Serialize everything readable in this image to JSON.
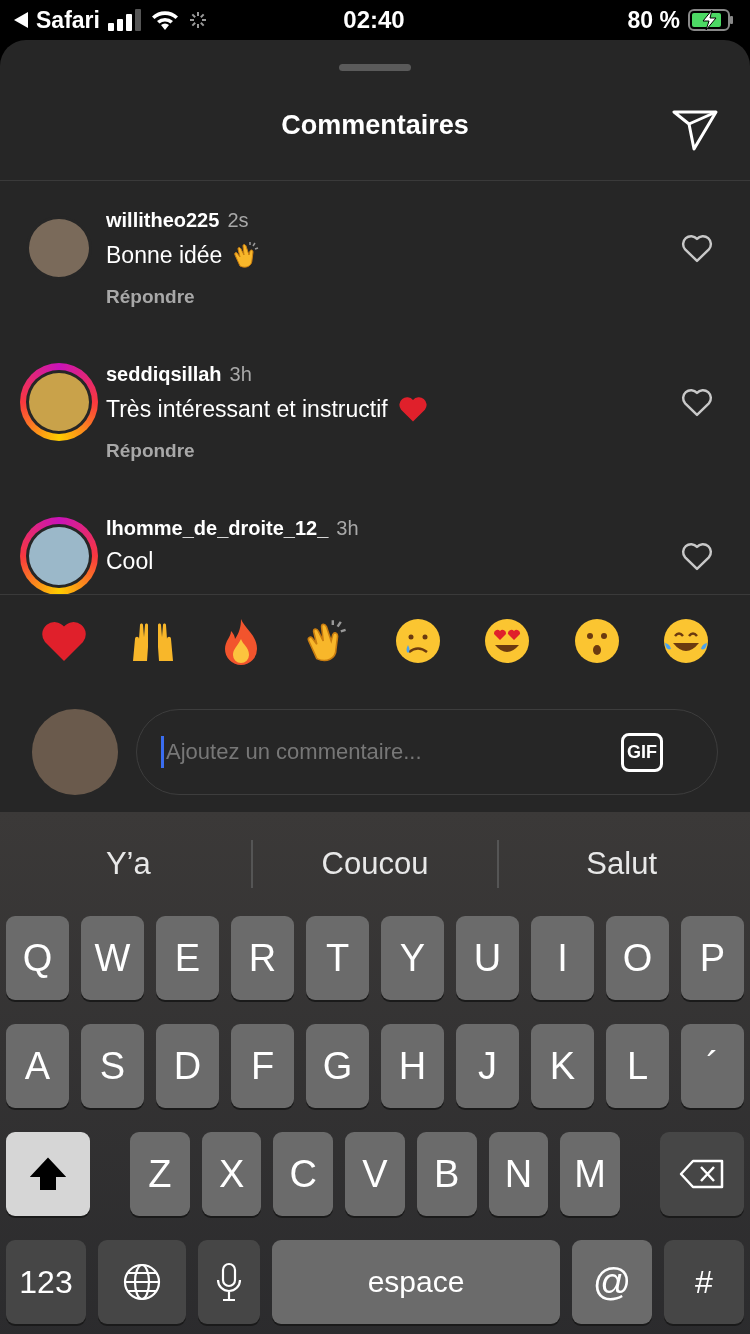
{
  "status_bar": {
    "back_label": "Safari",
    "time": "02:40",
    "battery_text": "80 %",
    "charging": true
  },
  "sheet": {
    "title": "Commentaires"
  },
  "comments": [
    {
      "username": "willitheo225",
      "time": "2s",
      "text": "Bonne idée",
      "kind": "clap_emoji",
      "reply": "Répondre",
      "story_ring": false,
      "liked": false
    },
    {
      "username": "seddiqsillah",
      "time": "3h",
      "text": "Très intéressant et instructif",
      "kind": "heart_emoji",
      "reply": "Répondre",
      "story_ring": true,
      "liked": false
    },
    {
      "username": "lhomme_de_droite_12_",
      "time": "3h",
      "text": "Cool",
      "story_ring": true,
      "liked": false
    }
  ],
  "composer": {
    "placeholder": "Ajoutez un commentaire...",
    "gif_label": "GIF"
  },
  "suggestions": [
    "Y’a",
    "Coucou",
    "Salut"
  ],
  "keyboard": {
    "row_1": [
      {
        "kind": "letter",
        "label": "Q"
      },
      {
        "kind": "letter",
        "label": "W"
      },
      {
        "kind": "letter",
        "label": "E"
      },
      {
        "kind": "letter",
        "label": "R"
      },
      {
        "kind": "letter",
        "label": "T"
      },
      {
        "kind": "letter",
        "label": "Y"
      },
      {
        "kind": "letter",
        "label": "U"
      },
      {
        "kind": "letter",
        "label": "I"
      },
      {
        "kind": "letter",
        "label": "O"
      },
      {
        "kind": "letter",
        "label": "P"
      }
    ],
    "row_2": [
      {
        "kind": "letter",
        "label": "A"
      },
      {
        "kind": "letter",
        "label": "S"
      },
      {
        "kind": "letter",
        "label": "D"
      },
      {
        "kind": "letter",
        "label": "F"
      },
      {
        "kind": "letter",
        "label": "G"
      },
      {
        "kind": "letter",
        "label": "H"
      },
      {
        "kind": "letter",
        "label": "J"
      },
      {
        "kind": "letter",
        "label": "K"
      },
      {
        "kind": "letter",
        "label": "L"
      },
      {
        "kind": "letter",
        "label": "´"
      }
    ],
    "row_3": [
      {
        "kind": "shift",
        "on": true
      },
      {
        "kind": "letter",
        "label": "Z"
      },
      {
        "kind": "letter",
        "label": "X"
      },
      {
        "kind": "letter",
        "label": "C"
      },
      {
        "kind": "letter",
        "label": "V"
      },
      {
        "kind": "letter",
        "label": "B"
      },
      {
        "kind": "letter",
        "label": "N"
      },
      {
        "kind": "letter",
        "label": "M"
      },
      {
        "kind": "backspace"
      }
    ],
    "bottom_row": [
      {
        "kind": "mode",
        "label": "123"
      },
      {
        "kind": "globe"
      },
      {
        "kind": "mic"
      },
      {
        "kind": "space",
        "label": "espace"
      },
      {
        "kind": "symbol",
        "label": "@"
      },
      {
        "kind": "mode",
        "label": "#"
      }
    ]
  }
}
